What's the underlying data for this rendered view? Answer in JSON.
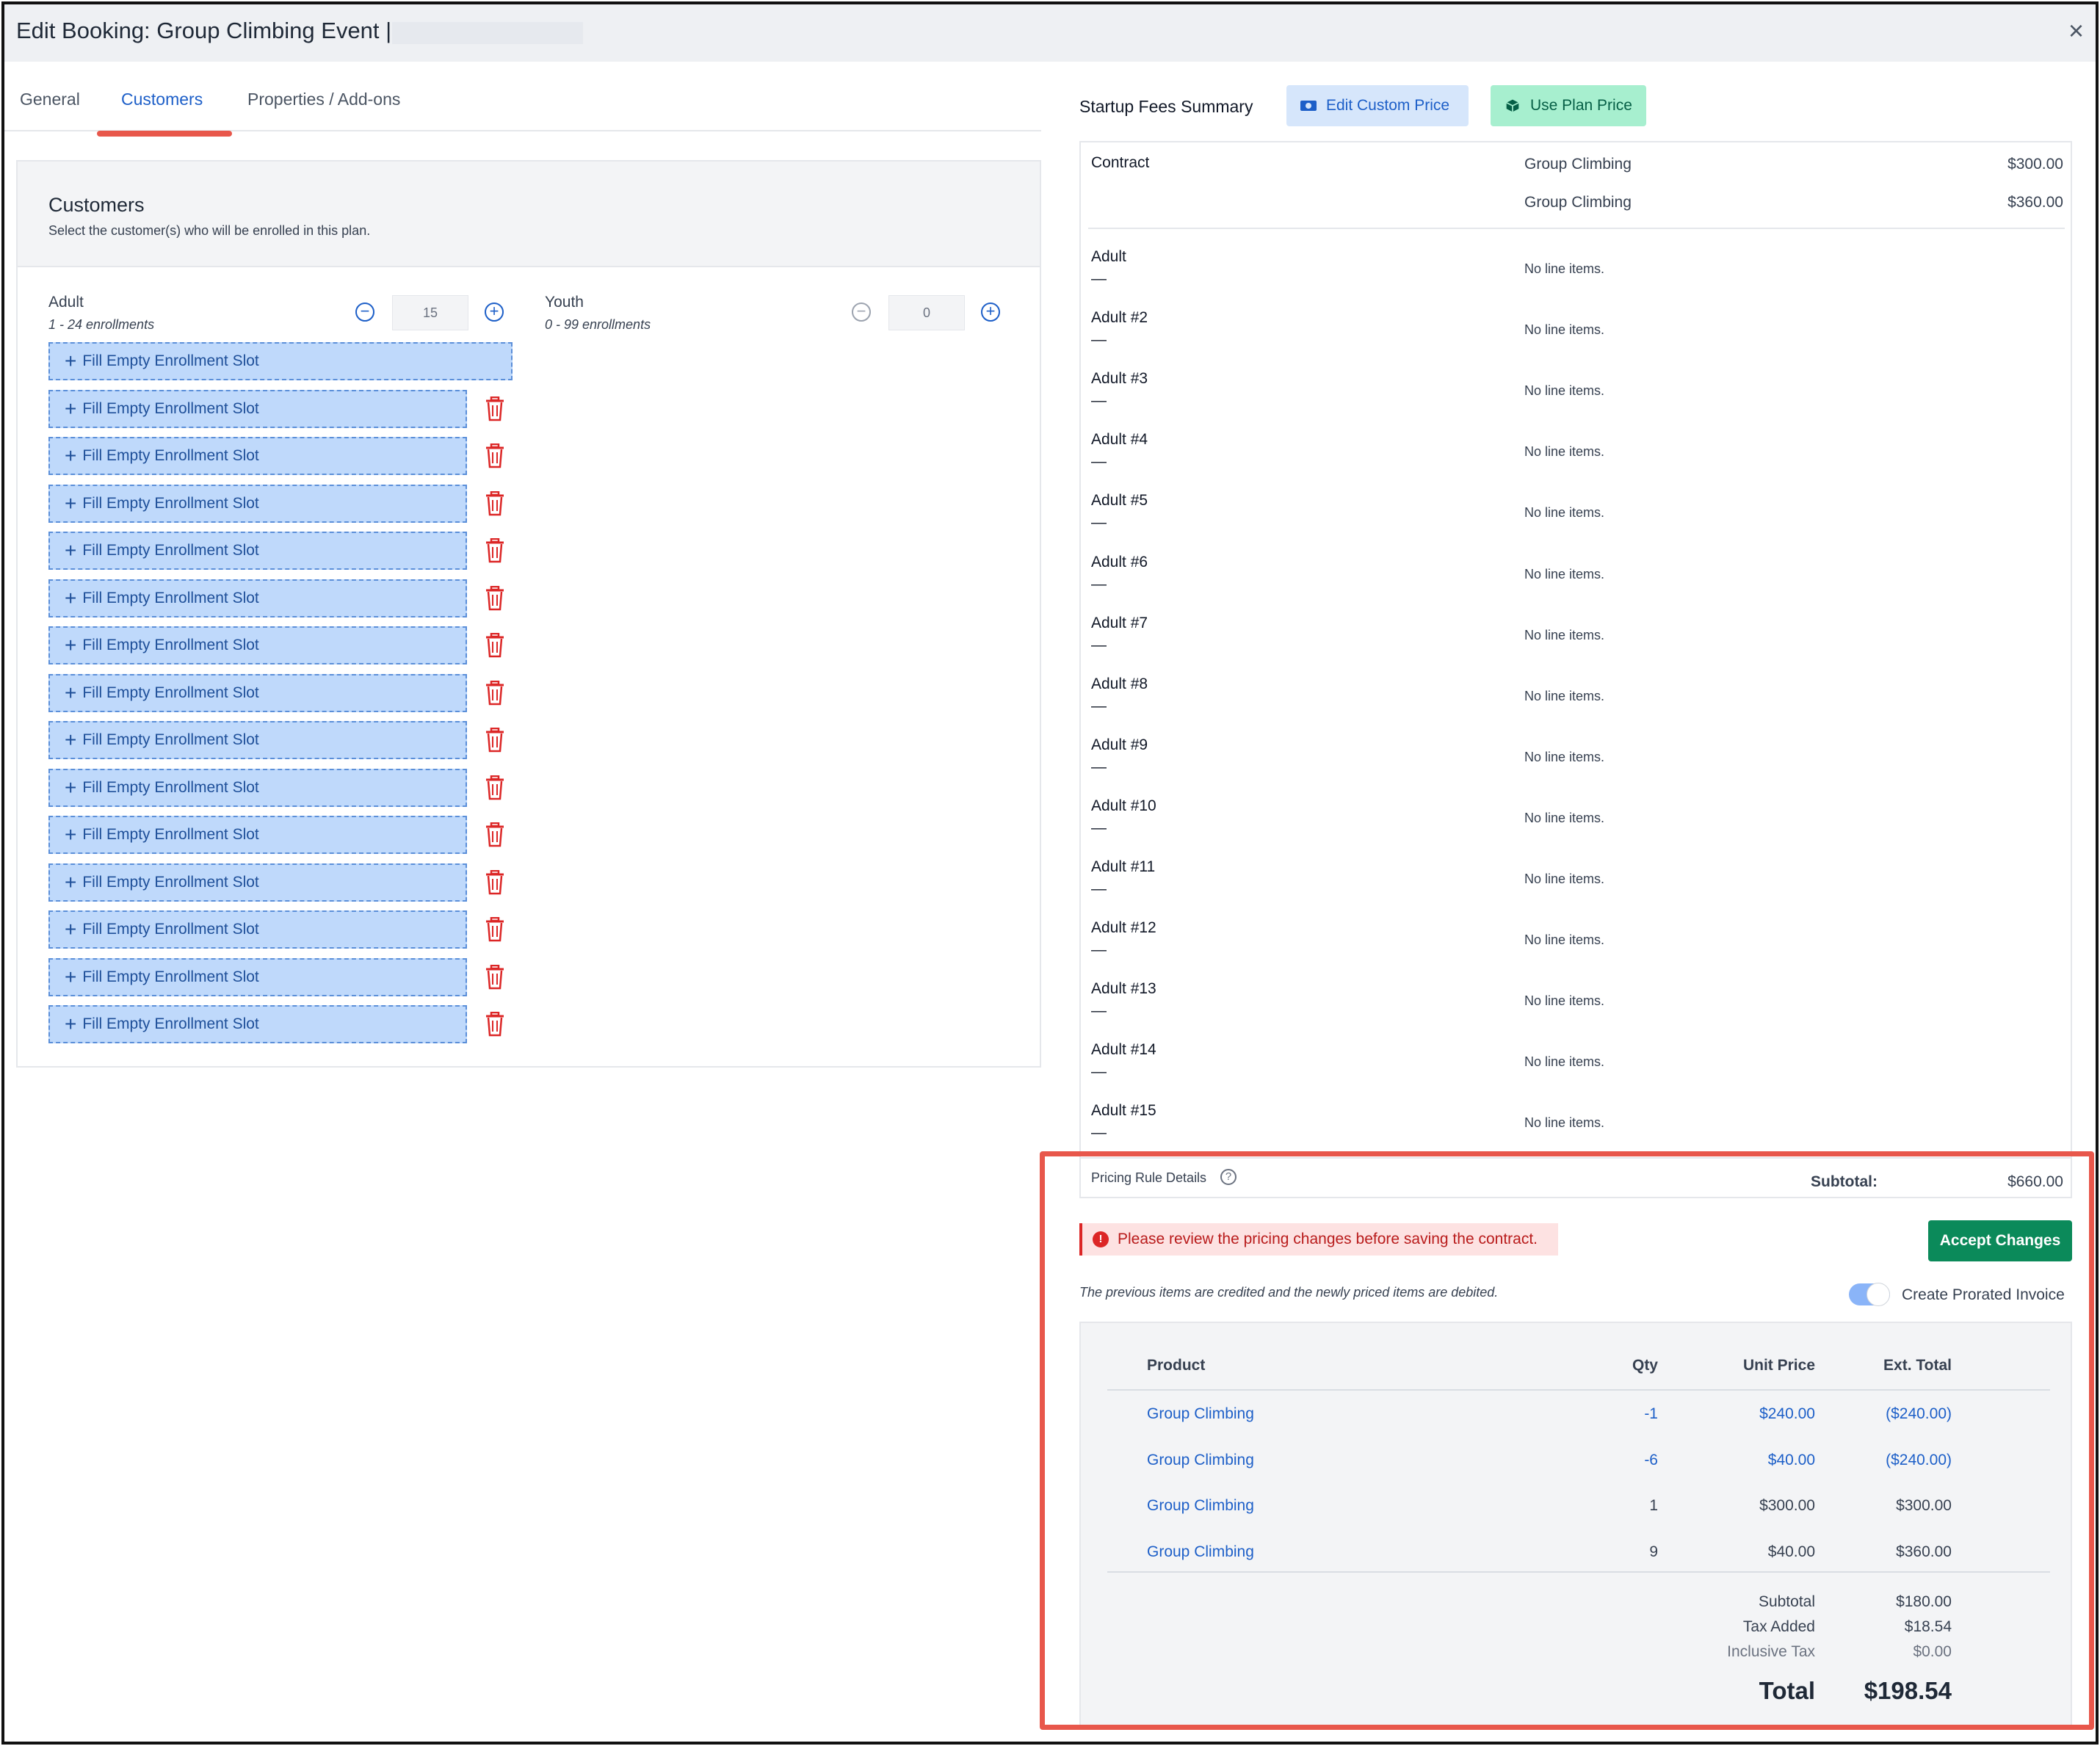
{
  "window": {
    "title": "Edit Booking: Group Climbing Event | ."
  },
  "tabs": [
    {
      "label": "General"
    },
    {
      "label": "Customers"
    },
    {
      "label": "Properties / Add-ons"
    }
  ],
  "customers_panel": {
    "title": "Customers",
    "subtitle": "Select the customer(s) who will be enrolled in this plan.",
    "adult": {
      "label": "Adult",
      "range": "1 - 24 enrollments",
      "qty": "15"
    },
    "youth": {
      "label": "Youth",
      "range": "0 - 99 enrollments",
      "qty": "0"
    },
    "slot_label": "Fill Empty Enrollment Slot",
    "slot_count": 15
  },
  "summary": {
    "title": "Startup Fees Summary",
    "edit_custom_price": "Edit Custom Price",
    "use_plan_price": "Use Plan Price",
    "contract": {
      "label": "Contract",
      "lines": [
        {
          "item": "Group Climbing",
          "amount": "$300.00"
        },
        {
          "item": "Group Climbing",
          "amount": "$360.00"
        }
      ]
    },
    "dash": "—",
    "no_items": "No line items.",
    "adults": [
      "Adult",
      "Adult #2",
      "Adult #3",
      "Adult #4",
      "Adult #5",
      "Adult #6",
      "Adult #7",
      "Adult #8",
      "Adult #9",
      "Adult #10",
      "Adult #11",
      "Adult #12",
      "Adult #13",
      "Adult #14",
      "Adult #15"
    ],
    "pricing_rule_details": "Pricing Rule Details",
    "help_icon": "?",
    "subtotal_label": "Subtotal:",
    "subtotal_value": "$660.00"
  },
  "review": {
    "alert_icon": "!",
    "alert": "Please review the pricing changes before saving the contract.",
    "accept_button": "Accept Changes",
    "note": "The previous items are credited and the newly priced items are debited.",
    "toggle_label": "Create Prorated Invoice",
    "toggle_on": true
  },
  "invoice": {
    "headers": {
      "product": "Product",
      "qty": "Qty",
      "unit_price": "Unit Price",
      "ext_total": "Ext. Total"
    },
    "rows": [
      {
        "product": "Group Climbing",
        "qty": "-1",
        "unit_price": "$240.00",
        "ext_total": "($240.00)",
        "credit": true
      },
      {
        "product": "Group Climbing",
        "qty": "-6",
        "unit_price": "$40.00",
        "ext_total": "($240.00)",
        "credit": true
      },
      {
        "product": "Group Climbing",
        "qty": "1",
        "unit_price": "$300.00",
        "ext_total": "$300.00",
        "credit": false
      },
      {
        "product": "Group Climbing",
        "qty": "9",
        "unit_price": "$40.00",
        "ext_total": "$360.00",
        "credit": false
      }
    ],
    "subtotal_label": "Subtotal",
    "subtotal": "$180.00",
    "tax_label": "Tax Added",
    "tax": "$18.54",
    "inclusive_tax_label": "Inclusive Tax",
    "inclusive_tax": "$0.00",
    "total_label": "Total",
    "total": "$198.54"
  },
  "colors": {
    "accent": "#1d5fc8",
    "highlight": "#e8574b",
    "accept": "#0b8a5a",
    "alert": "#dc2626"
  }
}
